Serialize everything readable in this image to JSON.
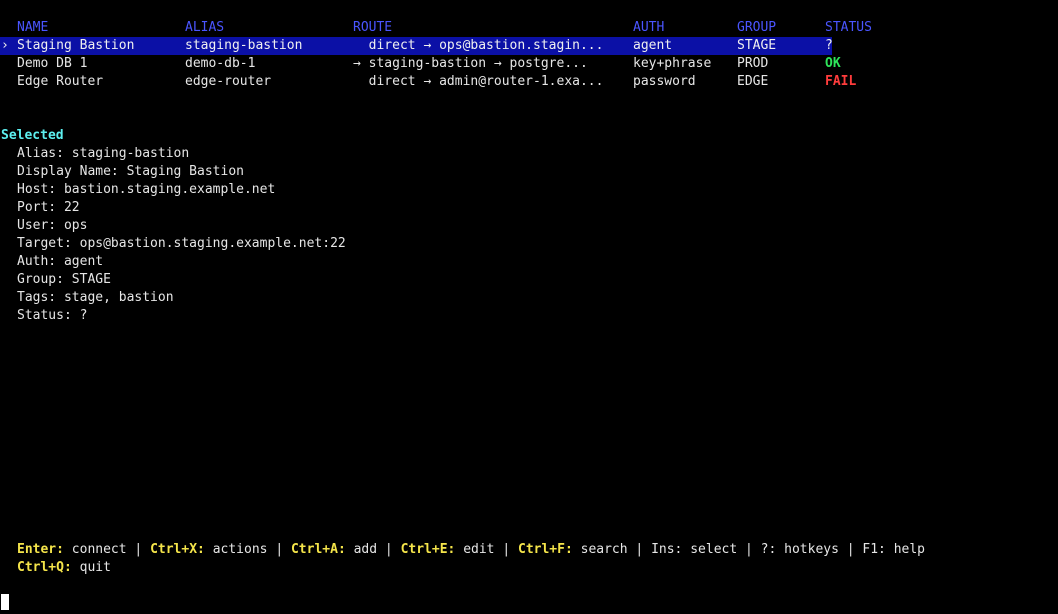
{
  "table": {
    "headers": {
      "name": "NAME",
      "alias": "ALIAS",
      "route": "ROUTE",
      "auth": "AUTH",
      "group": "GROUP",
      "status": "STATUS"
    },
    "selected_marker": ">",
    "rows": [
      {
        "marker": "›",
        "name": "Staging Bastion",
        "alias": "staging-bastion",
        "route": "  direct → ops@bastion.stagin...",
        "auth": "agent",
        "group": "STAGE",
        "status": "?"
      },
      {
        "marker": "",
        "name": "Demo DB 1",
        "alias": "demo-db-1",
        "route": "→ staging-bastion → postgre...",
        "auth": "key+phrase",
        "group": "PROD",
        "status": "OK"
      },
      {
        "marker": "",
        "name": "Edge Router",
        "alias": "edge-router",
        "route": "  direct → admin@router-1.exa...",
        "auth": "password",
        "group": "EDGE",
        "status": "FAIL"
      }
    ]
  },
  "details": {
    "title": "Selected",
    "lines": [
      "Alias: staging-bastion",
      "Display Name: Staging Bastion",
      "Host: bastion.staging.example.net",
      "Port: 22",
      "User: ops",
      "Target: ops@bastion.staging.example.net:22",
      "Auth: agent",
      "Group: STAGE",
      "Tags: stage, bastion",
      "Status: ?"
    ]
  },
  "footer": {
    "keys": [
      {
        "key": "Enter:",
        "action": "connect"
      },
      {
        "key": "Ctrl+X:",
        "action": "actions"
      },
      {
        "key": "Ctrl+A:",
        "action": "add"
      },
      {
        "key": "Ctrl+E:",
        "action": "edit"
      },
      {
        "key": "Ctrl+F:",
        "action": "search"
      }
    ],
    "plain": "Ins: select | ?: hotkeys | F1: help",
    "separator": "|",
    "quit_key": "Ctrl+Q:",
    "quit_action": "quit"
  },
  "colors": {
    "background": "#000000",
    "header": "#4a55ff",
    "selection": "#0b10a6",
    "ok": "#2ee65b",
    "fail": "#ff3c3c",
    "section_title": "#5df0f0",
    "hotkey": "#f5e54a"
  }
}
